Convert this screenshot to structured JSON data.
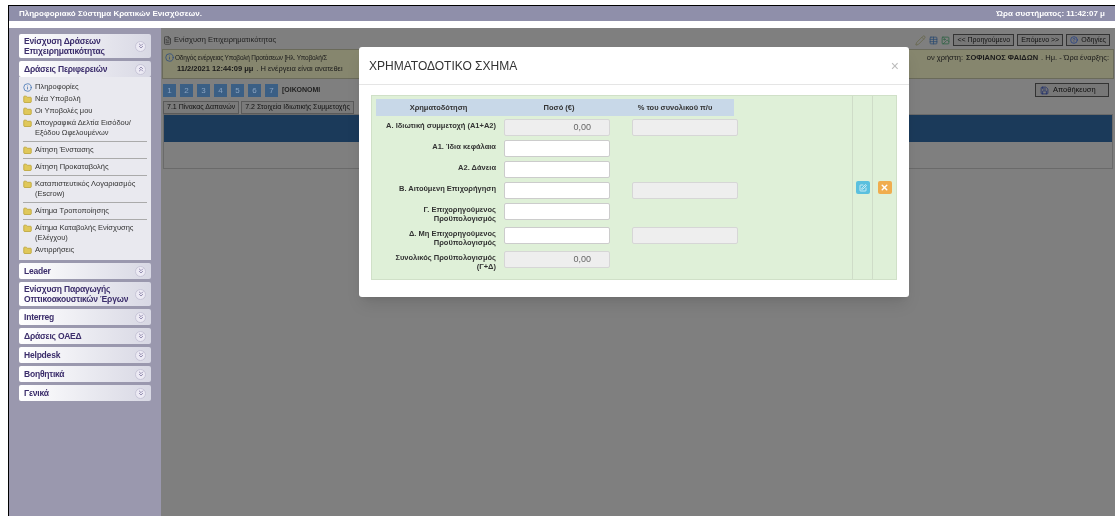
{
  "header": {
    "title": "Πληροφοριακό Σύστημα Κρατικών Ενισχύσεων.",
    "system_time": "Ώρα συστήματος: 11:42:07 μ"
  },
  "sidebar": {
    "sections": [
      {
        "label": "Ενίσχυση Δράσεων Επιχειρηματικότητας",
        "expanded": false
      },
      {
        "label": "Δράσεις Περιφερειών",
        "expanded": true,
        "items": [
          {
            "kind": "info",
            "label": "Πληροφορίες"
          },
          {
            "kind": "folder",
            "label": "Νέα Υποβολή"
          },
          {
            "kind": "folder",
            "label": "Οι Υποβολές μου"
          },
          {
            "kind": "folder",
            "label": "Απογραφικά Δελτία Εισόδου/ Εξόδου Ωφελουμένων"
          },
          {
            "kind": "folder",
            "label": "Αίτηση Ένστασης"
          },
          {
            "kind": "folder",
            "label": "Αίτηση Προκαταβολής"
          },
          {
            "kind": "folder",
            "label": "Καταπιστευτικός Λογαριασμός (Escrow)"
          },
          {
            "kind": "folder",
            "label": "Αίτημα Τροποποίησης"
          },
          {
            "kind": "folder",
            "label": "Αίτημα Καταβολής Ενίσχυσης (Ελέγχου)"
          },
          {
            "kind": "folder",
            "label": "Αντιρρήσεις"
          }
        ]
      },
      {
        "label": "Leader",
        "expanded": false
      },
      {
        "label": "Ενίσχυση Παραγωγής Οπτικοακουστικών Έργων",
        "expanded": false
      },
      {
        "label": "Interreg",
        "expanded": false
      },
      {
        "label": "Δράσεις ΟΑΕΔ",
        "expanded": false
      },
      {
        "label": "Helpdesk",
        "expanded": false
      },
      {
        "label": "Βοηθητικά",
        "expanded": false
      },
      {
        "label": "Γενικά",
        "expanded": false
      }
    ]
  },
  "main": {
    "breadcrumb": "Ενίσχυση Επιχειρηματικότητας",
    "toolbar": {
      "previous": "<< Προηγούμενο",
      "next": "Επόμενο >>",
      "help": "Οδηγίες"
    },
    "info": {
      "line_1": "Οδηγός ενέργειας Υποβολή Προτάσεων [Ηλ. Υποβολή/Σ",
      "user_text": "ον χρήστη:",
      "user_name": "ΣΟΦΙΑΝΟΣ ΦΑΙΔΩΝ",
      "start_text": ". Ημ. - Ώρα έναρξης:",
      "date": "11/2/2021 12:44:09 μμ",
      "line_2": ". Η ενέργεια είναι ανατεθει"
    },
    "steps": [
      "1",
      "2",
      "3",
      "4",
      "5",
      "6",
      "7"
    ],
    "step_label": "[ΟΙΚΟΝΟΜΙ",
    "save": "Αποθήκευση",
    "tabs": [
      "7.1 Πίνακας Δαπανών",
      "7.2 Στοιχεία Ιδιωτικής Συμμετοχής"
    ]
  },
  "modal": {
    "title": "ΧΡΗΜΑΤΟΔΟΤΙΚΟ ΣΧΗΜΑ",
    "close": "×",
    "columns": [
      "Χρηματοδότηση",
      "Ποσό (€)",
      "% του συνολικού π/υ"
    ],
    "rows": [
      {
        "label": "Α. Ιδιωτική συμμετοχή (Α1+Α2)",
        "amount": {
          "kind": "readonly",
          "value": "0,00"
        },
        "percent": {
          "kind": "readonly"
        }
      },
      {
        "label": "Α1. Ίδια κεφάλαια",
        "amount": {
          "kind": "input"
        }
      },
      {
        "label": "Α2. Δάνεια",
        "amount": {
          "kind": "input"
        }
      },
      {
        "label": "Β. Αιτούμενη Επιχορήγηση",
        "amount": {
          "kind": "input"
        },
        "percent": {
          "kind": "readonly"
        }
      },
      {
        "label": "Γ. Επιχορηγούμενος Προϋπολογισμός",
        "amount": {
          "kind": "input"
        }
      },
      {
        "label": "Δ. Μη Επιχορηγούμενος Προϋπολογισμός",
        "amount": {
          "kind": "input"
        },
        "percent": {
          "kind": "readonly"
        }
      },
      {
        "label": "Συνολικός Προϋπολογισμός (Γ+Δ)",
        "amount": {
          "kind": "readonly",
          "value": "0,00"
        }
      }
    ]
  }
}
